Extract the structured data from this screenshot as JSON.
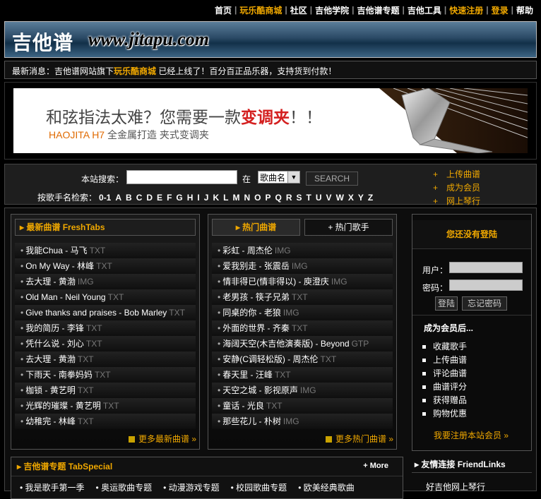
{
  "nav": {
    "items": [
      {
        "label": "首页",
        "hl": false
      },
      {
        "label": "玩乐酷商城",
        "hl": true
      },
      {
        "label": "社区",
        "hl": false
      },
      {
        "label": "吉他学院",
        "hl": false
      },
      {
        "label": "吉他谱专题",
        "hl": false
      },
      {
        "label": "吉他工具",
        "hl": false
      },
      {
        "label": "快速注册",
        "hl": true
      },
      {
        "label": "登录",
        "hl": true
      },
      {
        "label": "帮助",
        "hl": false
      }
    ]
  },
  "banner": {
    "title_zh": "吉他谱",
    "url": "www.jitapu.com"
  },
  "news": {
    "prefix": "最新消息：吉他谱网站旗下",
    "link": "玩乐酷商城",
    "suffix": " 已经上线了！百分百正品乐器，支持货到付款！"
  },
  "ad": {
    "line1_a": "和弦指法太难？您需要一款",
    "line1_b": "变调夹",
    "line1_c": "！！",
    "line2_brand": "HAOJITA H7",
    "line2_text": " 全金属打造 夹式变调夹"
  },
  "search": {
    "label": "本站搜索：",
    "in": "在",
    "select": "歌曲名",
    "button": "SEARCH",
    "alpha_label": "按歌手名检索：",
    "letters": [
      "0-1",
      "A",
      "B",
      "C",
      "D",
      "E",
      "F",
      "G",
      "H",
      "I",
      "J",
      "K",
      "L",
      "M",
      "N",
      "O",
      "P",
      "Q",
      "R",
      "S",
      "T",
      "U",
      "V",
      "W",
      "X",
      "Y",
      "Z"
    ],
    "links": [
      "上传曲谱",
      "成为会员",
      "网上琴行"
    ]
  },
  "fresh": {
    "title": "最新曲谱 FreshTabs",
    "more": "更多最新曲谱 »",
    "items": [
      {
        "name": "我能Chua - 马飞",
        "tag": "TXT"
      },
      {
        "name": "On My Way - 林峰",
        "tag": "TXT"
      },
      {
        "name": "去大理 - 黄渤",
        "tag": "IMG"
      },
      {
        "name": "Old Man - Neil Young",
        "tag": "TXT"
      },
      {
        "name": "Give thanks and praises - Bob Marley",
        "tag": "TXT"
      },
      {
        "name": "我的简历 - 李锋",
        "tag": "TXT"
      },
      {
        "name": "凭什么说 - 刘心",
        "tag": "TXT"
      },
      {
        "name": "去大理 - 黄渤",
        "tag": "TXT"
      },
      {
        "name": "下雨天 - 南拳妈妈",
        "tag": "TXT"
      },
      {
        "name": "枷锁 - 黄艺明",
        "tag": "TXT"
      },
      {
        "name": "光辉的璀璨 - 黄艺明",
        "tag": "TXT"
      },
      {
        "name": "幼稚完 - 林峰",
        "tag": "TXT"
      }
    ]
  },
  "hot": {
    "tab1": "热门曲谱",
    "tab2": "+ 热门歌手",
    "more": "更多热门曲谱 »",
    "items": [
      {
        "name": "彩虹 - 周杰伦",
        "tag": "IMG"
      },
      {
        "name": "爱我别走 - 张震岳",
        "tag": "IMG"
      },
      {
        "name": "情非得已(情非得以) - 庾澄庆",
        "tag": "IMG"
      },
      {
        "name": "老男孩 - 筷子兄弟",
        "tag": "TXT"
      },
      {
        "name": "同桌的你 - 老狼",
        "tag": "IMG"
      },
      {
        "name": "外面的世界 - 齐秦",
        "tag": "TXT"
      },
      {
        "name": "海阔天空(木吉他演奏版) - Beyond",
        "tag": "GTP"
      },
      {
        "name": "安静(C调轻松版) - 周杰伦",
        "tag": "TXT"
      },
      {
        "name": "春天里 - 汪峰",
        "tag": "TXT"
      },
      {
        "name": "天空之城 - 影视原声",
        "tag": "IMG"
      },
      {
        "name": "童话 - 光良",
        "tag": "TXT"
      },
      {
        "name": "那些花儿 - 朴树",
        "tag": "IMG"
      }
    ]
  },
  "login": {
    "title": "您还没有登陆",
    "user": "用户：",
    "pass": "密码：",
    "btn_login": "登陆",
    "btn_forgot": "忘记密码",
    "benefits_title": "成为会员后...",
    "benefits": [
      "收藏歌手",
      "上传曲谱",
      "评论曲谱",
      "曲谱评分",
      "获得赠品",
      "购物优惠"
    ],
    "register": "我要注册本站会员 »"
  },
  "special": {
    "title": "吉他谱专题 TabSpecial",
    "more": "+ More",
    "items": [
      "• 我是歌手第一季",
      "• 奥运歌曲专题",
      "• 动漫游戏专题",
      "• 校园歌曲专题",
      "• 欧美经典歌曲"
    ]
  },
  "friend": {
    "title": "友情连接 FriendLinks",
    "link": "好吉他网上琴行"
  }
}
